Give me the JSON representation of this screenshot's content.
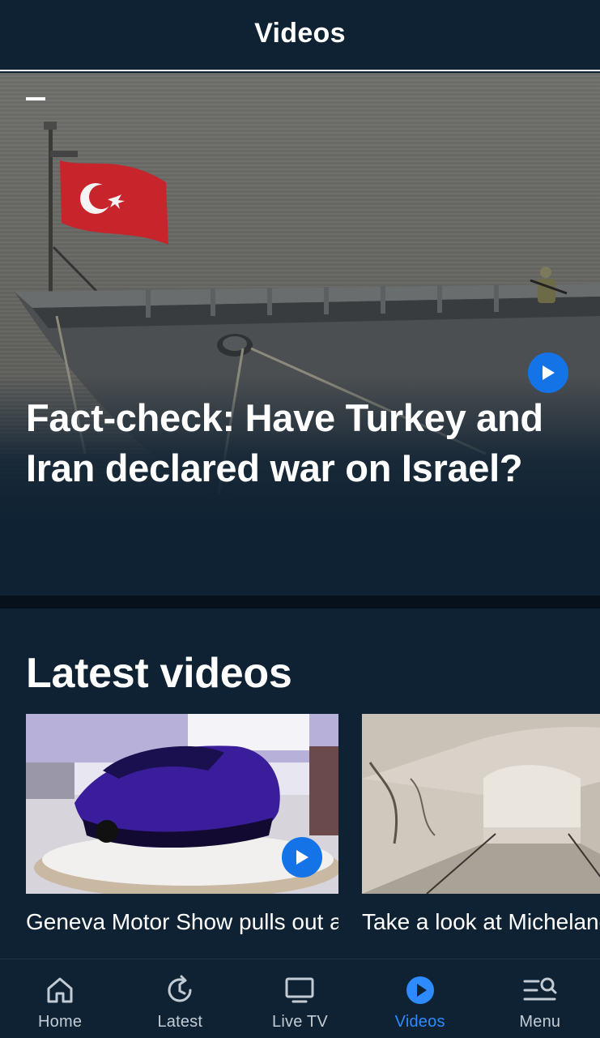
{
  "header": {
    "title": "Videos"
  },
  "hero": {
    "headline": "Fact-check: Have Turkey and Iran declared war on Israel?",
    "play_icon": "play-icon"
  },
  "latest": {
    "title": "Latest videos",
    "items": [
      {
        "caption": "Geneva Motor Show pulls out all the stops for its",
        "has_play": true
      },
      {
        "caption": "Take a look at Michelangelo's possi",
        "has_play": false
      }
    ]
  },
  "tabbar": {
    "items": [
      {
        "label": "Home",
        "icon": "home-icon",
        "active": false
      },
      {
        "label": "Latest",
        "icon": "clock-refresh-icon",
        "active": false
      },
      {
        "label": "Live TV",
        "icon": "tv-icon",
        "active": false
      },
      {
        "label": "Videos",
        "icon": "play-circle-icon",
        "active": true
      },
      {
        "label": "Menu",
        "icon": "menu-search-icon",
        "active": false
      }
    ]
  },
  "colors": {
    "background": "#0f2233",
    "accent": "#1473e6",
    "active_tab": "#2e8bff",
    "inactive_tab": "#c3ccd4"
  }
}
